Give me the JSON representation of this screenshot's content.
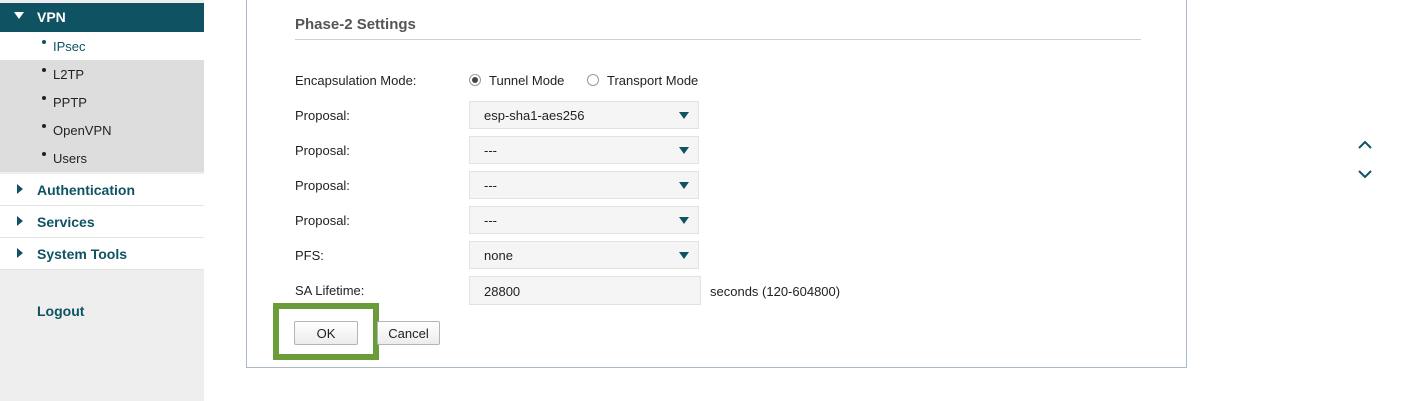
{
  "sidebar": {
    "vpn_label": "VPN",
    "sub_items": [
      "IPsec",
      "L2TP",
      "PPTP",
      "OpenVPN",
      "Users"
    ],
    "active_sub": "IPsec",
    "main_items": [
      "Authentication",
      "Services",
      "System Tools"
    ],
    "logout_label": "Logout"
  },
  "phase2": {
    "title": "Phase-2 Settings",
    "encapsulation": {
      "label": "Encapsulation Mode:",
      "options": [
        "Tunnel Mode",
        "Transport Mode"
      ],
      "selected": "Tunnel Mode"
    },
    "proposals": [
      {
        "label": "Proposal:",
        "value": "esp-sha1-aes256"
      },
      {
        "label": "Proposal:",
        "value": "---"
      },
      {
        "label": "Proposal:",
        "value": "---"
      },
      {
        "label": "Proposal:",
        "value": "---"
      }
    ],
    "pfs": {
      "label": "PFS:",
      "value": "none"
    },
    "sa_lifetime": {
      "label": "SA Lifetime:",
      "value": "28800",
      "hint": "seconds (120-604800)"
    }
  },
  "buttons": {
    "ok": "OK",
    "cancel": "Cancel"
  },
  "icons": {
    "scroll_up": "chevron-up-icon",
    "scroll_down": "chevron-down-icon"
  },
  "colors": {
    "brand": "#0f5363",
    "highlight": "#6b9c3a",
    "sidebar_bg": "#eeeeee"
  }
}
